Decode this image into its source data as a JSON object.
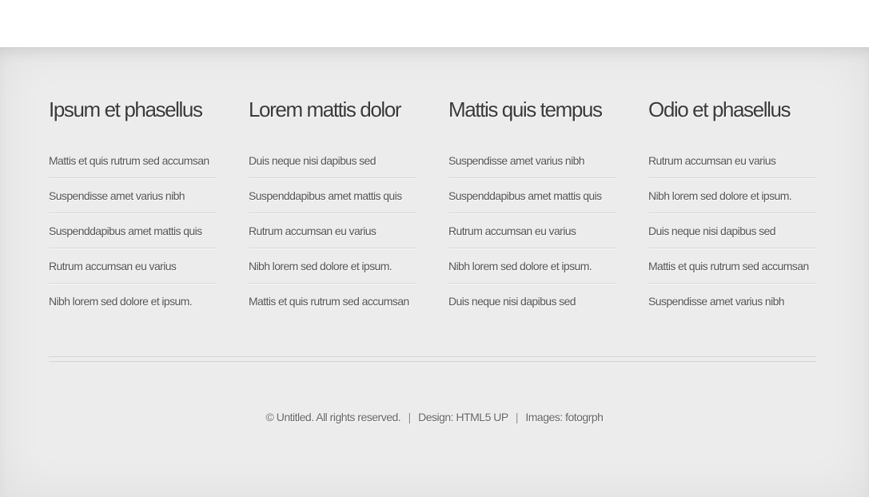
{
  "columns": [
    {
      "heading": "Ipsum et phasellus",
      "links": [
        "Mattis et quis rutrum sed accumsan",
        "Suspendisse amet varius nibh",
        "Suspenddapibus amet mattis quis",
        "Rutrum accumsan eu varius",
        "Nibh lorem sed dolore et ipsum."
      ]
    },
    {
      "heading": "Lorem mattis dolor",
      "links": [
        "Duis neque nisi dapibus sed",
        "Suspenddapibus amet mattis quis",
        "Rutrum accumsan eu varius",
        "Nibh lorem sed dolore et ipsum.",
        "Mattis et quis rutrum sed accumsan"
      ]
    },
    {
      "heading": "Mattis quis tempus",
      "links": [
        "Suspendisse amet varius nibh",
        "Suspenddapibus amet mattis quis",
        "Rutrum accumsan eu varius",
        "Nibh lorem sed dolore et ipsum.",
        "Duis neque nisi dapibus sed"
      ]
    },
    {
      "heading": "Odio et phasellus",
      "links": [
        "Rutrum accumsan eu varius",
        "Nibh lorem sed dolore et ipsum.",
        "Duis neque nisi dapibus sed",
        "Mattis et quis rutrum sed accumsan",
        "Suspendisse amet varius nibh"
      ]
    }
  ],
  "copyright": {
    "text": "© Untitled. All rights reserved.",
    "separator": "|",
    "design_label": "Design:",
    "design_link": "HTML5 UP",
    "images_label": "Images:",
    "images_link": "fotogrph"
  },
  "colors": {
    "background": "#ececec",
    "heading": "#3a3a3a",
    "link": "#555555",
    "rule": "#d6d6d6"
  }
}
